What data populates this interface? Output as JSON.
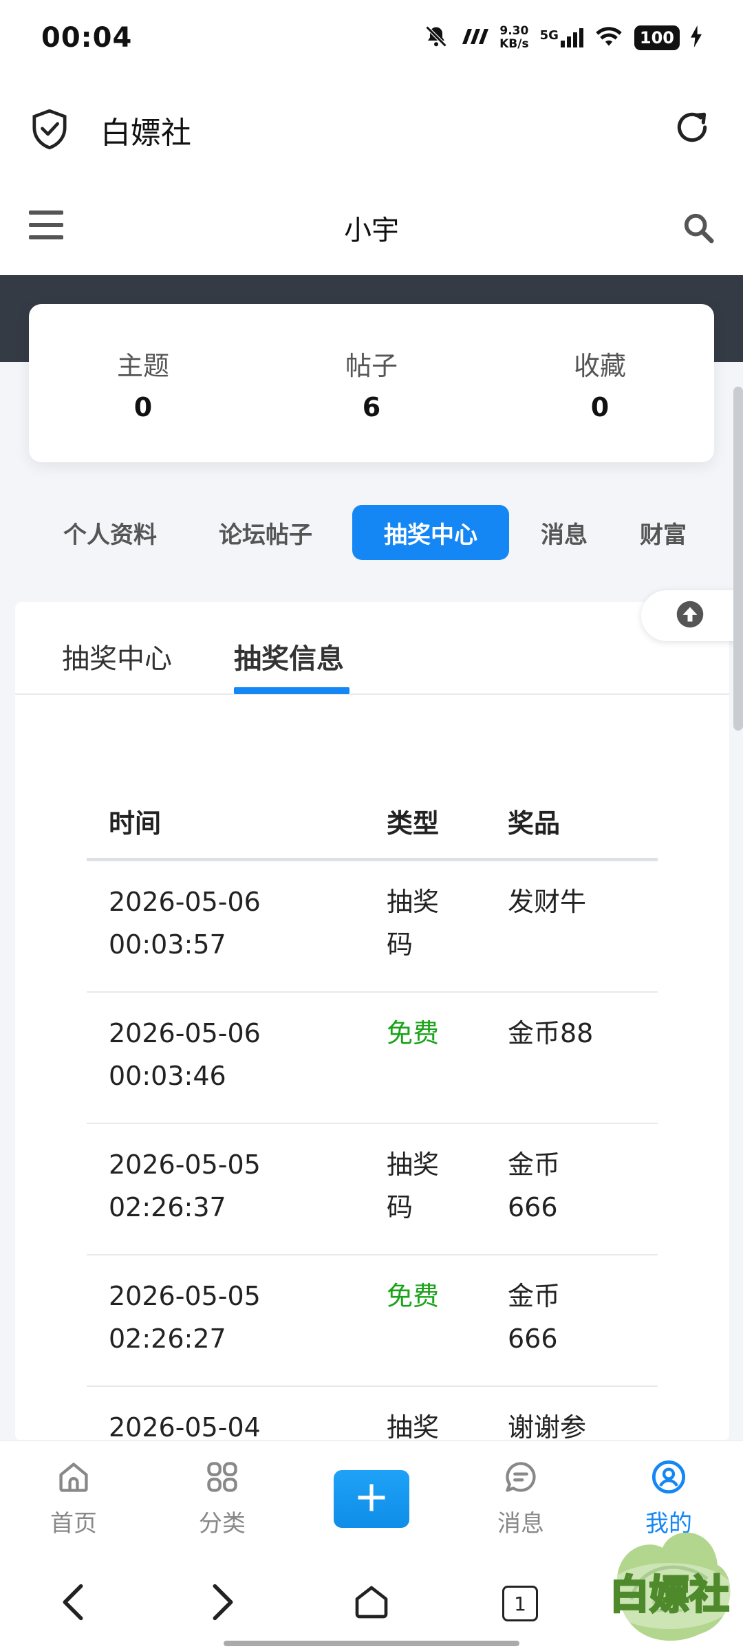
{
  "status": {
    "time": "00:04",
    "speed_value": "9.30",
    "speed_unit": "KB/s",
    "network": "5G",
    "battery": "100"
  },
  "app": {
    "title": "白嫖社"
  },
  "header": {
    "title": "小宇"
  },
  "stats": [
    {
      "label": "主题",
      "value": "0"
    },
    {
      "label": "帖子",
      "value": "6"
    },
    {
      "label": "收藏",
      "value": "0"
    }
  ],
  "tabs": [
    {
      "label": "个人资料"
    },
    {
      "label": "论坛帖子"
    },
    {
      "label": "抽奖中心"
    },
    {
      "label": "消息"
    },
    {
      "label": "财富"
    }
  ],
  "subtabs": [
    {
      "label": "抽奖中心"
    },
    {
      "label": "抽奖信息"
    }
  ],
  "table": {
    "headers": [
      "时间",
      "类型",
      "奖品"
    ],
    "rows": [
      {
        "date": "2026-05-06",
        "time": "00:03:57",
        "type1": "抽奖",
        "type2": "码",
        "prize1": "发财牛",
        "prize2": ""
      },
      {
        "date": "2026-05-06",
        "time": "00:03:46",
        "type1": "免费",
        "type2": "",
        "prize1": "金币88",
        "prize2": ""
      },
      {
        "date": "2026-05-05",
        "time": "02:26:37",
        "type1": "抽奖",
        "type2": "码",
        "prize1": "金币",
        "prize2": "666"
      },
      {
        "date": "2026-05-05",
        "time": "02:26:27",
        "type1": "免费",
        "type2": "",
        "prize1": "金币",
        "prize2": "666"
      },
      {
        "date": "2026-05-04",
        "time": "",
        "type1": "抽奖",
        "type2": "",
        "prize1": "谢谢参",
        "prize2": ""
      }
    ]
  },
  "bottom_nav": [
    {
      "label": "首页"
    },
    {
      "label": "分类"
    },
    {
      "label": "消息"
    },
    {
      "label": "我的"
    }
  ],
  "system_nav": {
    "tabs_count": "1"
  },
  "watermark": {
    "text": "白嫖社"
  },
  "colors": {
    "accent": "#1487f5",
    "free": "#19a319",
    "banner": "#343b45"
  }
}
